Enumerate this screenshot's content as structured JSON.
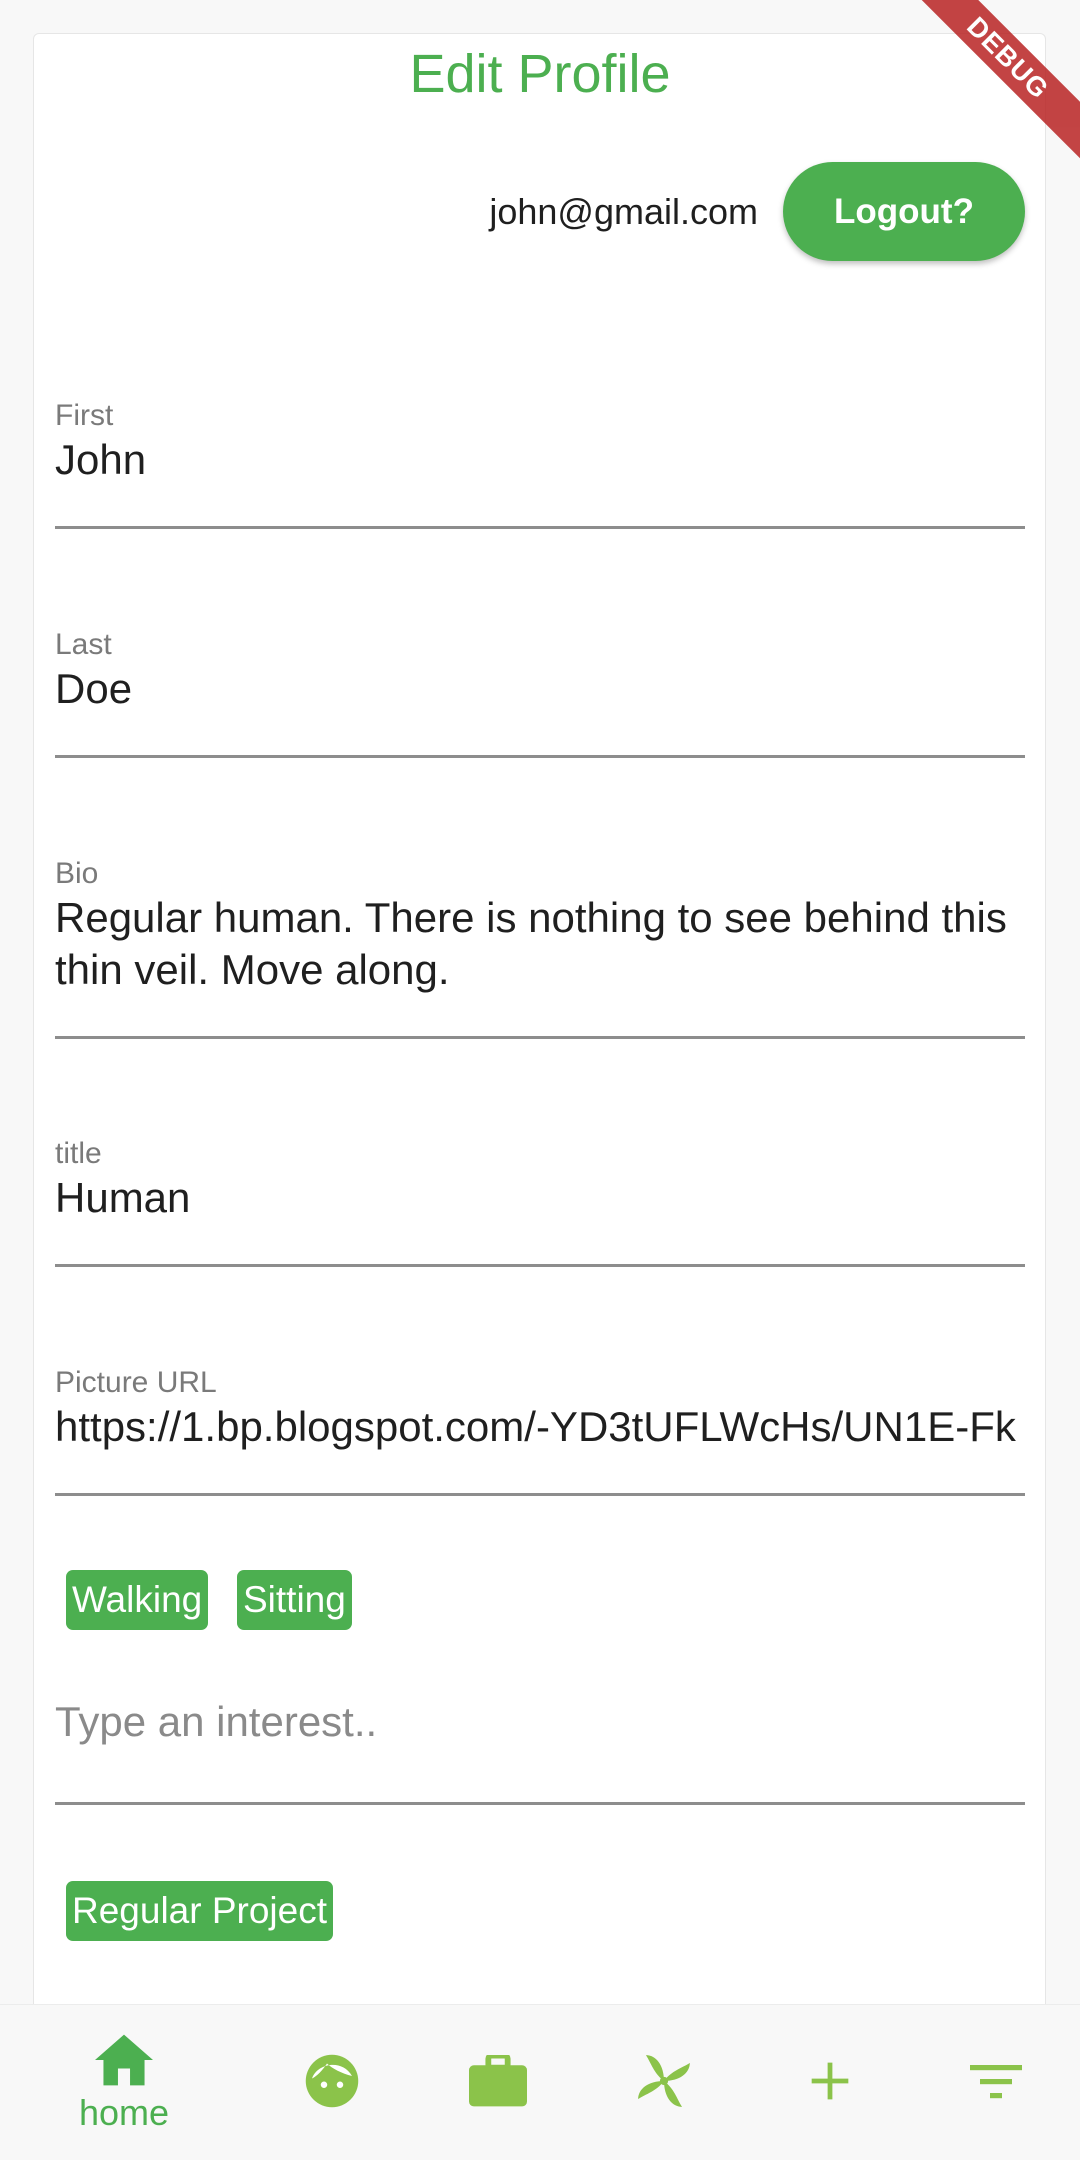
{
  "header": {
    "title": "Edit Profile",
    "email": "john@gmail.com",
    "logout_label": "Logout?"
  },
  "form": {
    "first": {
      "label": "First",
      "value": "John"
    },
    "last": {
      "label": "Last",
      "value": "Doe"
    },
    "bio": {
      "label": "Bio",
      "value": "Regular human. There is nothing to see behind this thin veil. Move along."
    },
    "title": {
      "label": "title",
      "value": "Human"
    },
    "picture_url": {
      "label": "Picture URL",
      "value": "https://1.bp.blogspot.com/-YD3tUFLWcHs/UN1E-Fk"
    }
  },
  "interests": {
    "chips": [
      "Walking",
      "Sitting"
    ],
    "placeholder": "Type an interest.."
  },
  "projects": {
    "chips": [
      "Regular Project"
    ]
  },
  "bottom_nav": {
    "items": [
      {
        "label": "home",
        "icon": "home-icon",
        "active": true
      },
      {
        "label": "",
        "icon": "face-icon",
        "active": false
      },
      {
        "label": "",
        "icon": "briefcase-icon",
        "active": false
      },
      {
        "label": "",
        "icon": "pinwheel-icon",
        "active": false
      },
      {
        "label": "",
        "icon": "add-icon",
        "active": false
      },
      {
        "label": "",
        "icon": "filter-icon",
        "active": false
      }
    ]
  },
  "debug_banner": "DEBUG",
  "colors": {
    "accent": "#4caf50",
    "icon_light": "#8bc34a",
    "debug": "#b71c1c"
  }
}
